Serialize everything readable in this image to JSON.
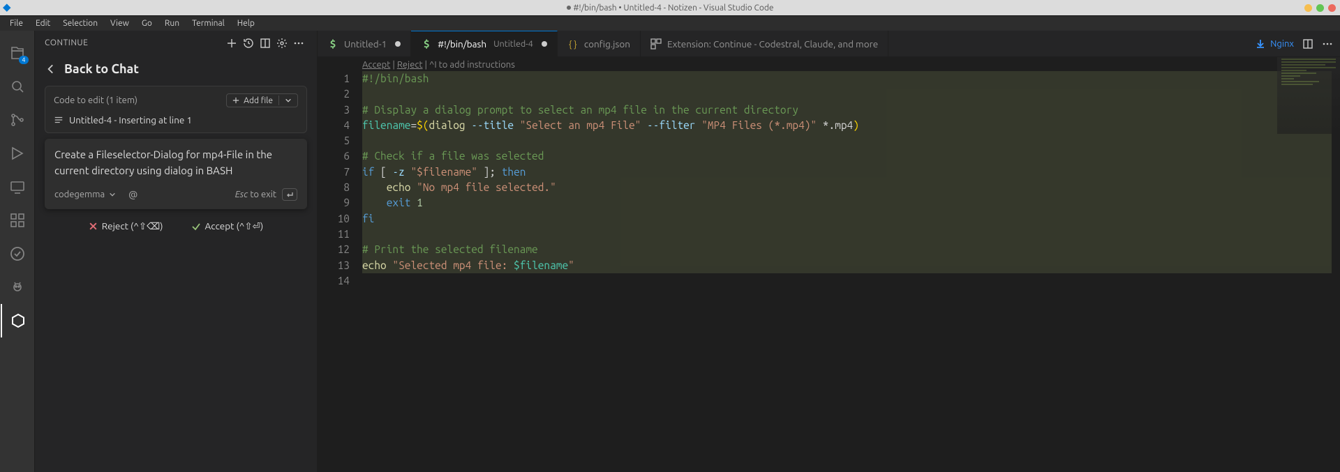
{
  "titlebar": {
    "title": "#!/bin/bash • Untitled-4 - Notizen - Visual Studio Code"
  },
  "menu": [
    "File",
    "Edit",
    "Selection",
    "View",
    "Go",
    "Run",
    "Terminal",
    "Help"
  ],
  "activity": {
    "explorer_badge": "4"
  },
  "sidebar": {
    "panel_title": "CONTINUE",
    "back_label": "Back to Chat",
    "card": {
      "title": "Code to edit (1 item)",
      "add_label": "Add file",
      "file_row": "Untitled-4 - Inserting at line 1"
    },
    "prompt": {
      "text": "Create a Fileselector-Dialog for mp4-File in the current directory using dialog in BASH",
      "model": "codegemma",
      "esc_label_a": "Esc",
      "esc_label_b": "to exit"
    },
    "actions": {
      "reject": "Reject (^⇧⌫)",
      "accept": "Accept (^⇧⏎)"
    }
  },
  "tabs": {
    "t1": {
      "label": "Untitled-1"
    },
    "t2": {
      "label": "#!/bin/bash",
      "sub": "Untitled-4"
    },
    "t3": {
      "label": "config.json"
    },
    "t4": {
      "label": "Extension: Continue - Codestral, Claude, and more"
    },
    "right": {
      "nginx": "Nginx"
    }
  },
  "codelens": {
    "accept": "Accept",
    "reject": "Reject",
    "hint": "^I to add instructions"
  },
  "code": {
    "l1_shebang": "#!/bin/bash",
    "l3_comment": "# Display a dialog prompt to select an mp4 file in the current directory",
    "l4_var": "filename",
    "l4_eq": "=",
    "l4_d": "$(",
    "l4_cmd": "dialog",
    "l4_f1": "--title",
    "l4_s1": "\"Select an mp4 File\"",
    "l4_f2": "--filter",
    "l4_s2": "\"MP4 Files (*.mp4)\"",
    "l4_glob": " *.mp4",
    "l4_close": ")",
    "l6_comment": "# Check if a file was selected",
    "l7": {
      "if": "if",
      "br": " [ ",
      "flag": "-z",
      "sp": " ",
      "str": "\"$filename\"",
      "br2": " ]; ",
      "then": "then"
    },
    "l8": {
      "indent": "    ",
      "echo": "echo",
      "sp": " ",
      "str": "\"No mp4 file selected.\""
    },
    "l9": {
      "indent": "    ",
      "exit": "exit",
      "sp": " ",
      "n": "1"
    },
    "l10": "fi",
    "l12_comment": "# Print the selected filename",
    "l13": {
      "echo": "echo",
      "sp": " ",
      "s1": "\"Selected mp4 file: ",
      "var": "$filename",
      "s2": "\""
    }
  }
}
